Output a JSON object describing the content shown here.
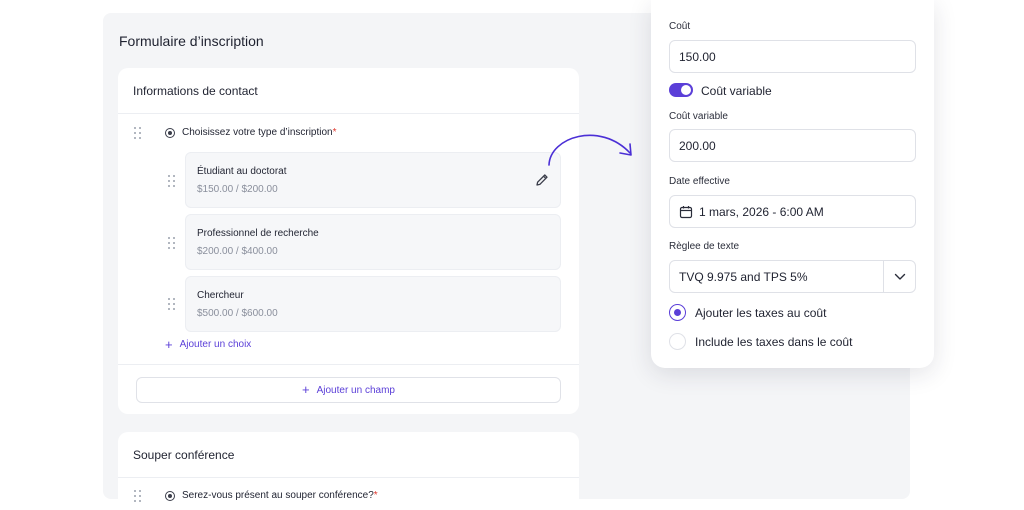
{
  "form": {
    "title": "Formulaire d’inscription"
  },
  "contact_section": {
    "title": "Informations de contact",
    "question": "Choisissez votre type d’inscription",
    "required_mark": "*",
    "choices": [
      {
        "name": "Étudiant au doctorat",
        "price": "$150.00 / $200.00"
      },
      {
        "name": "Professionnel de recherche",
        "price": "$200.00 / $400.00"
      },
      {
        "name": "Chercheur",
        "price": "$500.00 / $600.00"
      }
    ],
    "add_choice_label": "Ajouter un choix",
    "add_field_label": "Ajouter un champ"
  },
  "souper_section": {
    "title": "Souper conférence",
    "question": "Serez-vous présent au souper conférence?",
    "required_mark": "*"
  },
  "panel": {
    "cost_label": "Coût",
    "cost_value": "150.00",
    "variable_toggle_label": "Coût variable",
    "variable_toggle_on": true,
    "variable_cost_label": "Coût variable",
    "variable_cost_value": "200.00",
    "effective_date_label": "Date effective",
    "effective_date_value": "1 mars, 2026 - 6:00 AM",
    "tax_rule_label": "Règlee de texte",
    "tax_rule_value": "TVQ 9.975 and TPS 5%",
    "options": [
      {
        "label": "Ajouter les taxes au coût",
        "selected": true
      },
      {
        "label": "Include les taxes dans le coût",
        "selected": false
      }
    ]
  },
  "colors": {
    "accent": "#5b3fd8",
    "required": "#e0352b",
    "muted": "#8a8f9c",
    "canvas": "#f4f5f7"
  },
  "icons": [
    "drag-handle-icon",
    "radio-icon",
    "pencil-icon",
    "plus-icon",
    "calendar-icon",
    "chevron-down-icon",
    "curved-arrow-icon"
  ]
}
